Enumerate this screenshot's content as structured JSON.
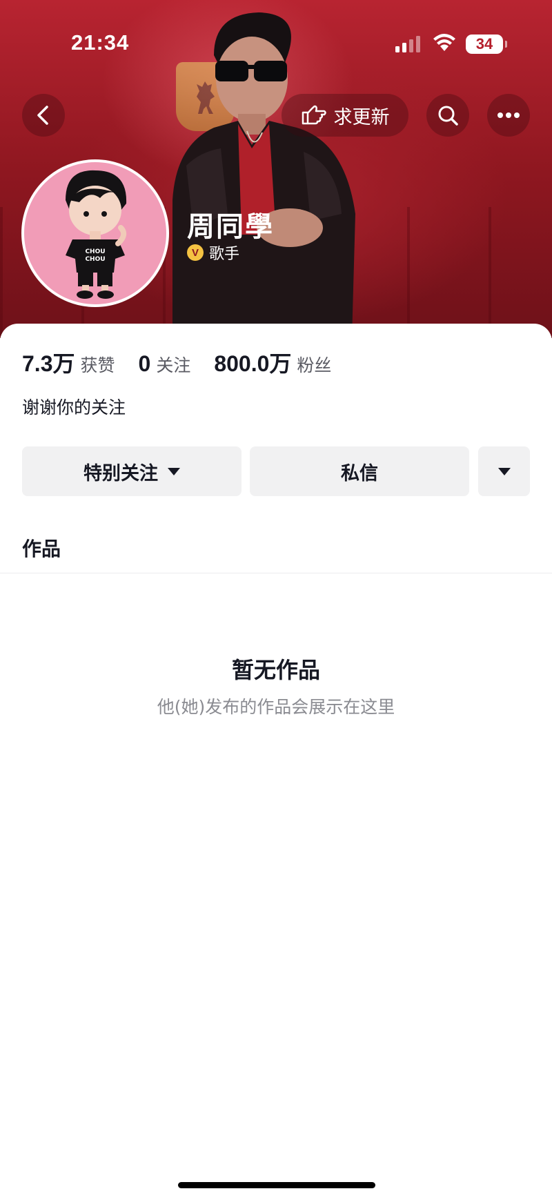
{
  "status_bar": {
    "time": "21:34",
    "battery": "34"
  },
  "header": {
    "request_update_label": "求更新",
    "icons": {
      "back": "chevron-left-icon",
      "hand": "pointing-hand-icon",
      "search": "search-icon",
      "more": "more-dots-icon"
    }
  },
  "profile": {
    "name": "周同學",
    "verified_label": "歌手",
    "verified_icon_letter": "V",
    "stats": [
      {
        "value": "7.3万",
        "label": "获赞"
      },
      {
        "value": "0",
        "label": "关注"
      },
      {
        "value": "800.0万",
        "label": "粉丝"
      }
    ],
    "bio": "谢谢你的关注"
  },
  "actions": {
    "follow_label": "特别关注",
    "message_label": "私信"
  },
  "tabs": {
    "works": "作品"
  },
  "empty_state": {
    "title": "暂无作品",
    "subtitle": "他(她)发布的作品会展示在这里"
  },
  "colors": {
    "banner": "#8f1720",
    "verified": "#f5c242",
    "avatar_bg": "#f19cb7"
  }
}
